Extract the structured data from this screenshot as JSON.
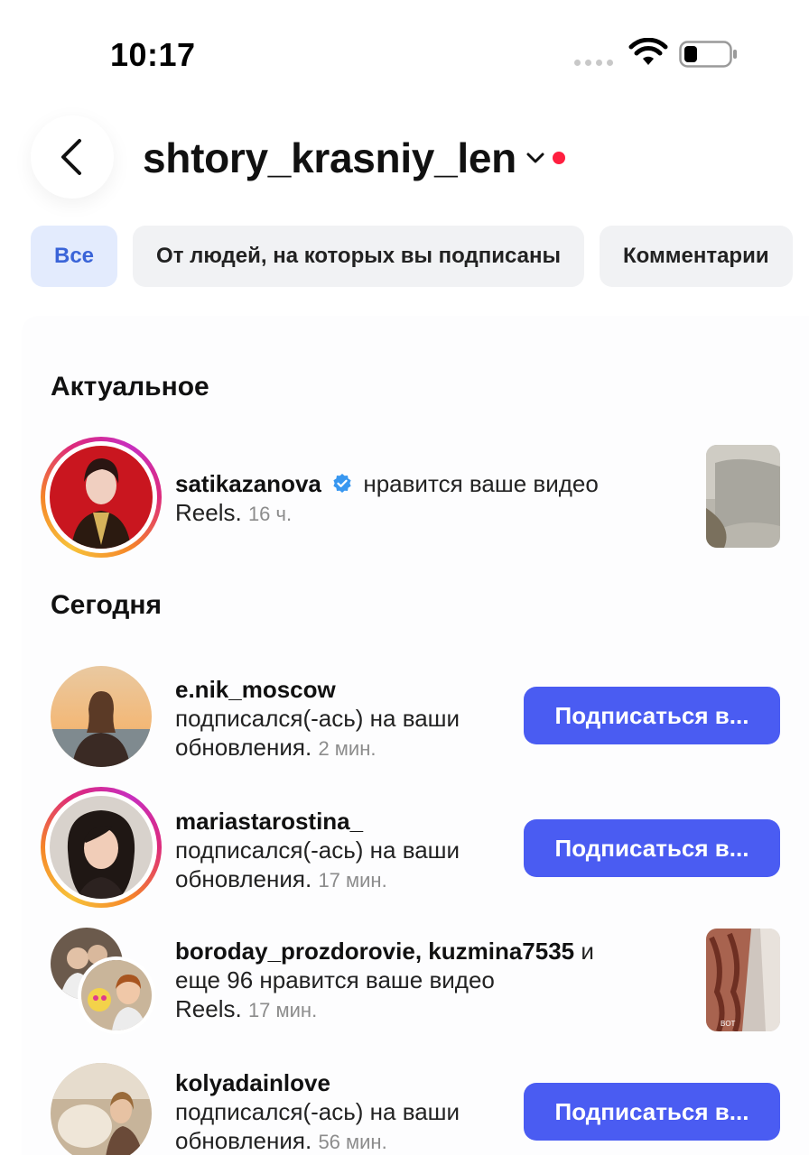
{
  "status_bar": {
    "time": "10:17"
  },
  "header": {
    "account_name": "shtory_krasniy_len"
  },
  "filters": [
    {
      "label": "Все",
      "active": true
    },
    {
      "label": "От людей, на которых вы подписаны",
      "active": false
    },
    {
      "label": "Комментарии",
      "active": false
    }
  ],
  "sections": {
    "highlights_title": "Актуальное",
    "today_title": "Сегодня"
  },
  "notifications": [
    {
      "username": "satikazanova",
      "verified": true,
      "action": "нравится ваше видео",
      "action2": "Reels.",
      "time": "16 ч."
    },
    {
      "username": "e.nik_moscow",
      "action": "подписался(-ась) на ваши",
      "action2": "обновления.",
      "time": "2 мин.",
      "button": "Подписаться в..."
    },
    {
      "username": "mariastarostina_",
      "action": "подписался(-ась) на ваши",
      "action2": "обновления.",
      "time": "17 мин.",
      "button": "Подписаться в..."
    },
    {
      "username": "boroday_prozdorovie",
      "username2": "kuzmina7535",
      "connector": "и",
      "action": "еще 96 нравится ваше видео",
      "action2": "Reels.",
      "time": "17 мин.",
      "thumb_caption": "BOT"
    },
    {
      "username": "kolyadainlove",
      "action": "подписался(-ась) на ваши",
      "action2": "обновления.",
      "time": "56 мин.",
      "button": "Подписаться в..."
    }
  ],
  "colors": {
    "accent": "#4a5cf2",
    "chip_active_bg": "#e3ebfd",
    "chip_active_text": "#3a64d8",
    "red_dot": "#ff1f3f",
    "verified": "#3897f0"
  }
}
